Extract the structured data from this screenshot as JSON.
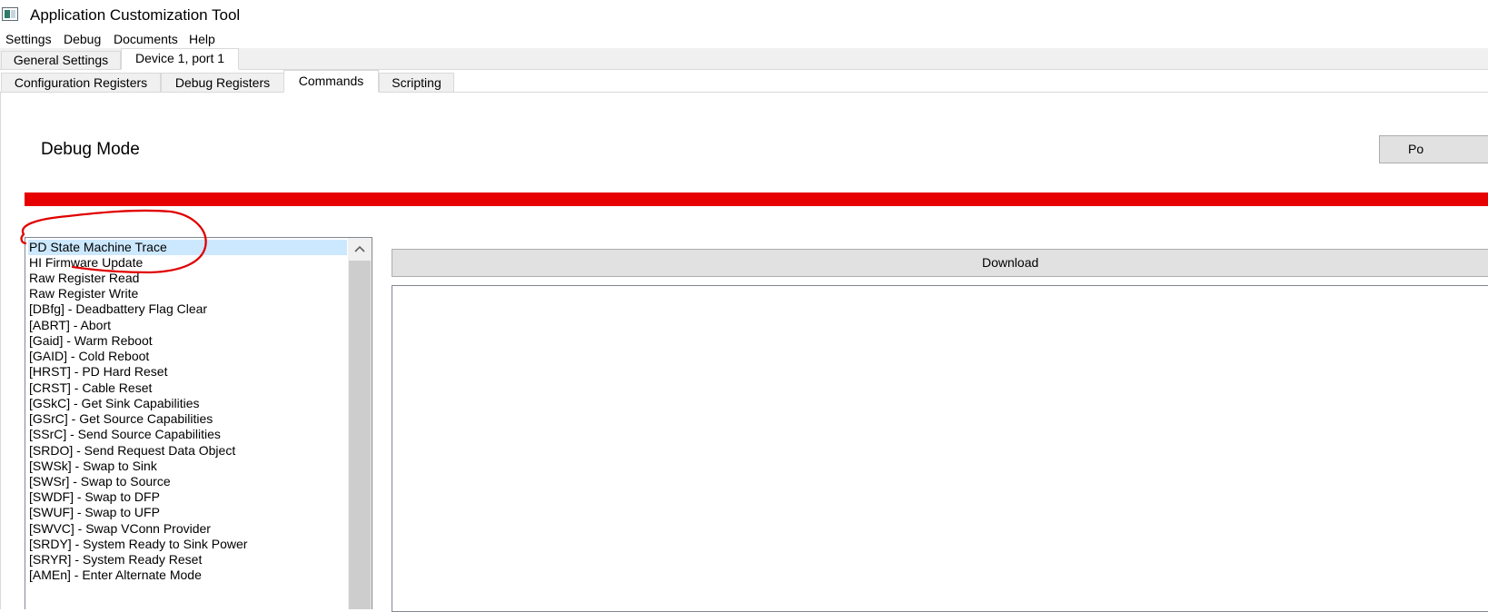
{
  "window": {
    "title": "Application Customization Tool"
  },
  "menu": [
    "Settings",
    "Debug",
    "Documents",
    "Help"
  ],
  "top_tabs": [
    {
      "label": "General Settings",
      "active": false
    },
    {
      "label": "Device 1, port 1",
      "active": true
    }
  ],
  "sub_tabs": [
    {
      "label": "Configuration Registers",
      "active": false
    },
    {
      "label": "Debug Registers",
      "active": false
    },
    {
      "label": "Commands",
      "active": true
    },
    {
      "label": "Scripting",
      "active": false
    }
  ],
  "panel": {
    "heading": "Debug Mode",
    "right_button_label": "Po",
    "status_bar_color": "#e60000",
    "download_label": "Download",
    "annotation_color": "#e00000"
  },
  "commands": [
    "PD State Machine Trace",
    "HI Firmware Update",
    "Raw Register Read",
    "Raw Register Write",
    "[DBfg] - Deadbattery Flag Clear",
    "[ABRT] - Abort",
    "[Gaid] - Warm Reboot",
    "[GAID] - Cold Reboot",
    "[HRST] - PD Hard Reset",
    "[CRST] - Cable Reset",
    "[GSkC] - Get Sink Capabilities",
    "[GSrC] - Get Source Capabilities",
    "[SSrC] - Send Source Capabilities",
    "[SRDO] - Send Request Data Object",
    "[SWSk] - Swap to Sink",
    "[SWSr] - Swap to Source",
    "[SWDF] - Swap to DFP",
    "[SWUF] - Swap to UFP",
    "[SWVC] - Swap VConn Provider",
    "[SRDY] - System Ready to Sink Power",
    "[SRYR] - System Ready Reset",
    "[AMEn] - Enter Alternate Mode"
  ],
  "selected_command_index": 0
}
